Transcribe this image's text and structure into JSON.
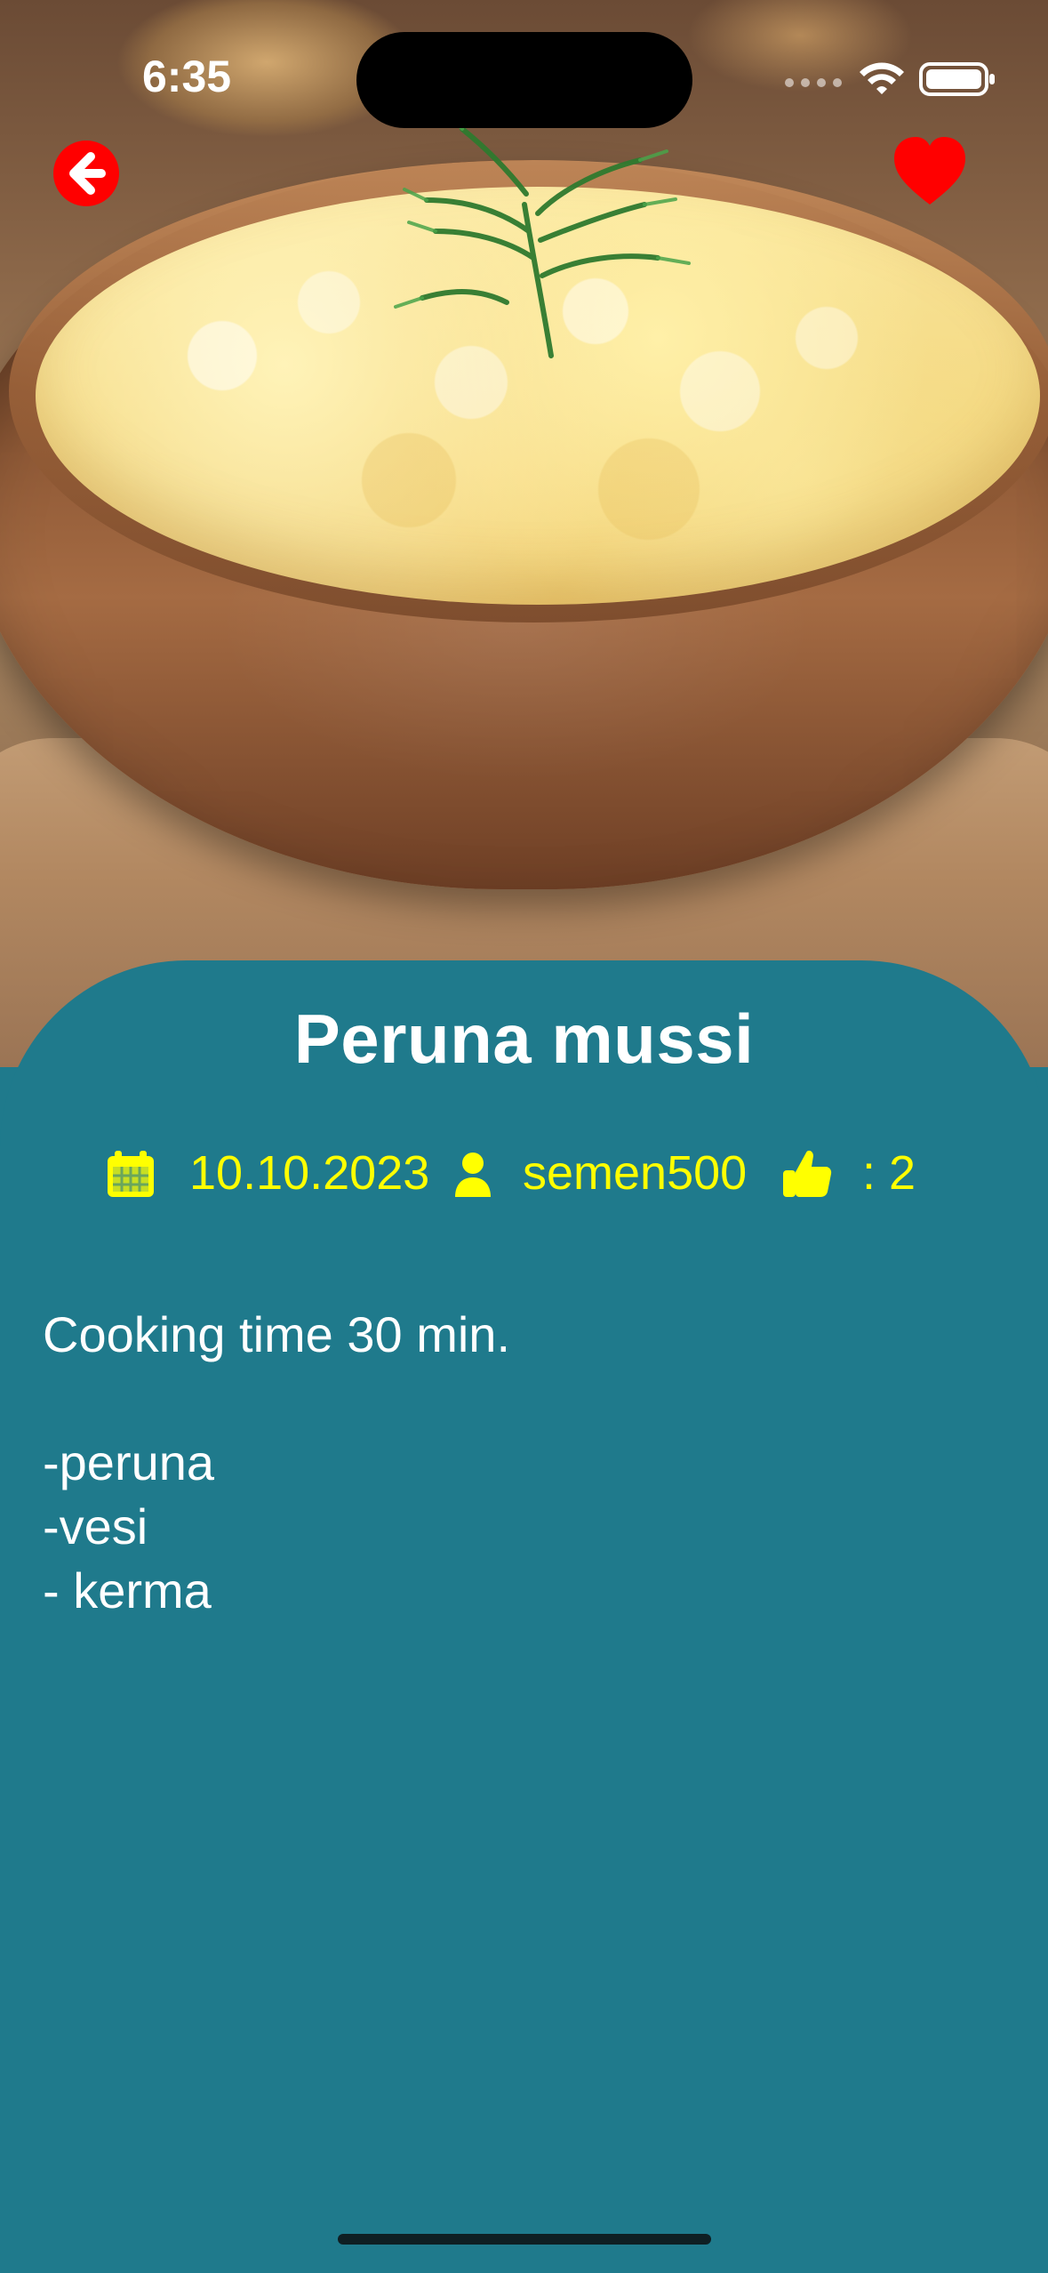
{
  "status_bar": {
    "time": "6:35"
  },
  "top_actions": {
    "back_icon": "arrow-left-circle",
    "favorite_icon": "heart",
    "favorite_color": "#ff0000"
  },
  "recipe": {
    "title": "Peruna mussi",
    "date": "10.10.2023",
    "author": "semen500",
    "likes_text": ": 2",
    "meta_color": "#ffff00",
    "card_color": "#1f7a8c",
    "description_lines": [
      "Cooking time 30 min.",
      "",
      "-peruna",
      "-vesi",
      "- kerma"
    ]
  }
}
